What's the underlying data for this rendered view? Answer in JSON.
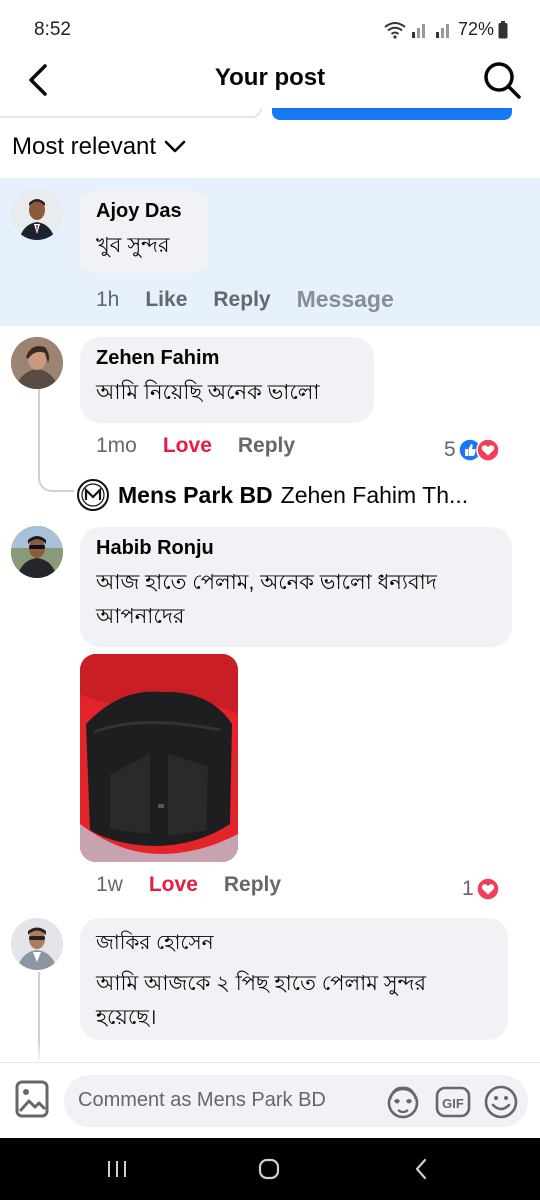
{
  "status_bar": {
    "time": "8:52",
    "battery": "72%"
  },
  "header": {
    "title": "Your post"
  },
  "sort": {
    "label": "Most relevant"
  },
  "comments": [
    {
      "author": "Ajoy Das",
      "text": "খুব সুন্দর",
      "time": "1h",
      "actions": [
        "Like",
        "Reply",
        "Message"
      ]
    },
    {
      "author": "Zehen Fahim",
      "text": "আমি নিয়েছি অনেক ভালো",
      "time": "1mo",
      "actions": [
        "Love",
        "Reply"
      ],
      "reaction_count": "5"
    },
    {
      "author": "Habib Ronju",
      "text": "আজ হাতে পেলাম, অনেক ভালো ধন্যবাদ আপনাদের",
      "time": "1w",
      "actions": [
        "Love",
        "Reply"
      ],
      "reaction_count": "1"
    },
    {
      "author": "জাকির হোসেন",
      "text": "আমি আজকে ২ পিছ হাতে পেলাম সুন্দর হয়েছে।"
    }
  ],
  "reply_preview": {
    "page_name": "Mens Park BD",
    "snippet": "Zehen Fahim Th..."
  },
  "comment_bar": {
    "placeholder": "Comment as Mens Park BD",
    "gif_label": "GIF"
  },
  "colors": {
    "accent": "#1877f2",
    "love": "#e41e3f",
    "highlight": "#e7f0fd"
  }
}
